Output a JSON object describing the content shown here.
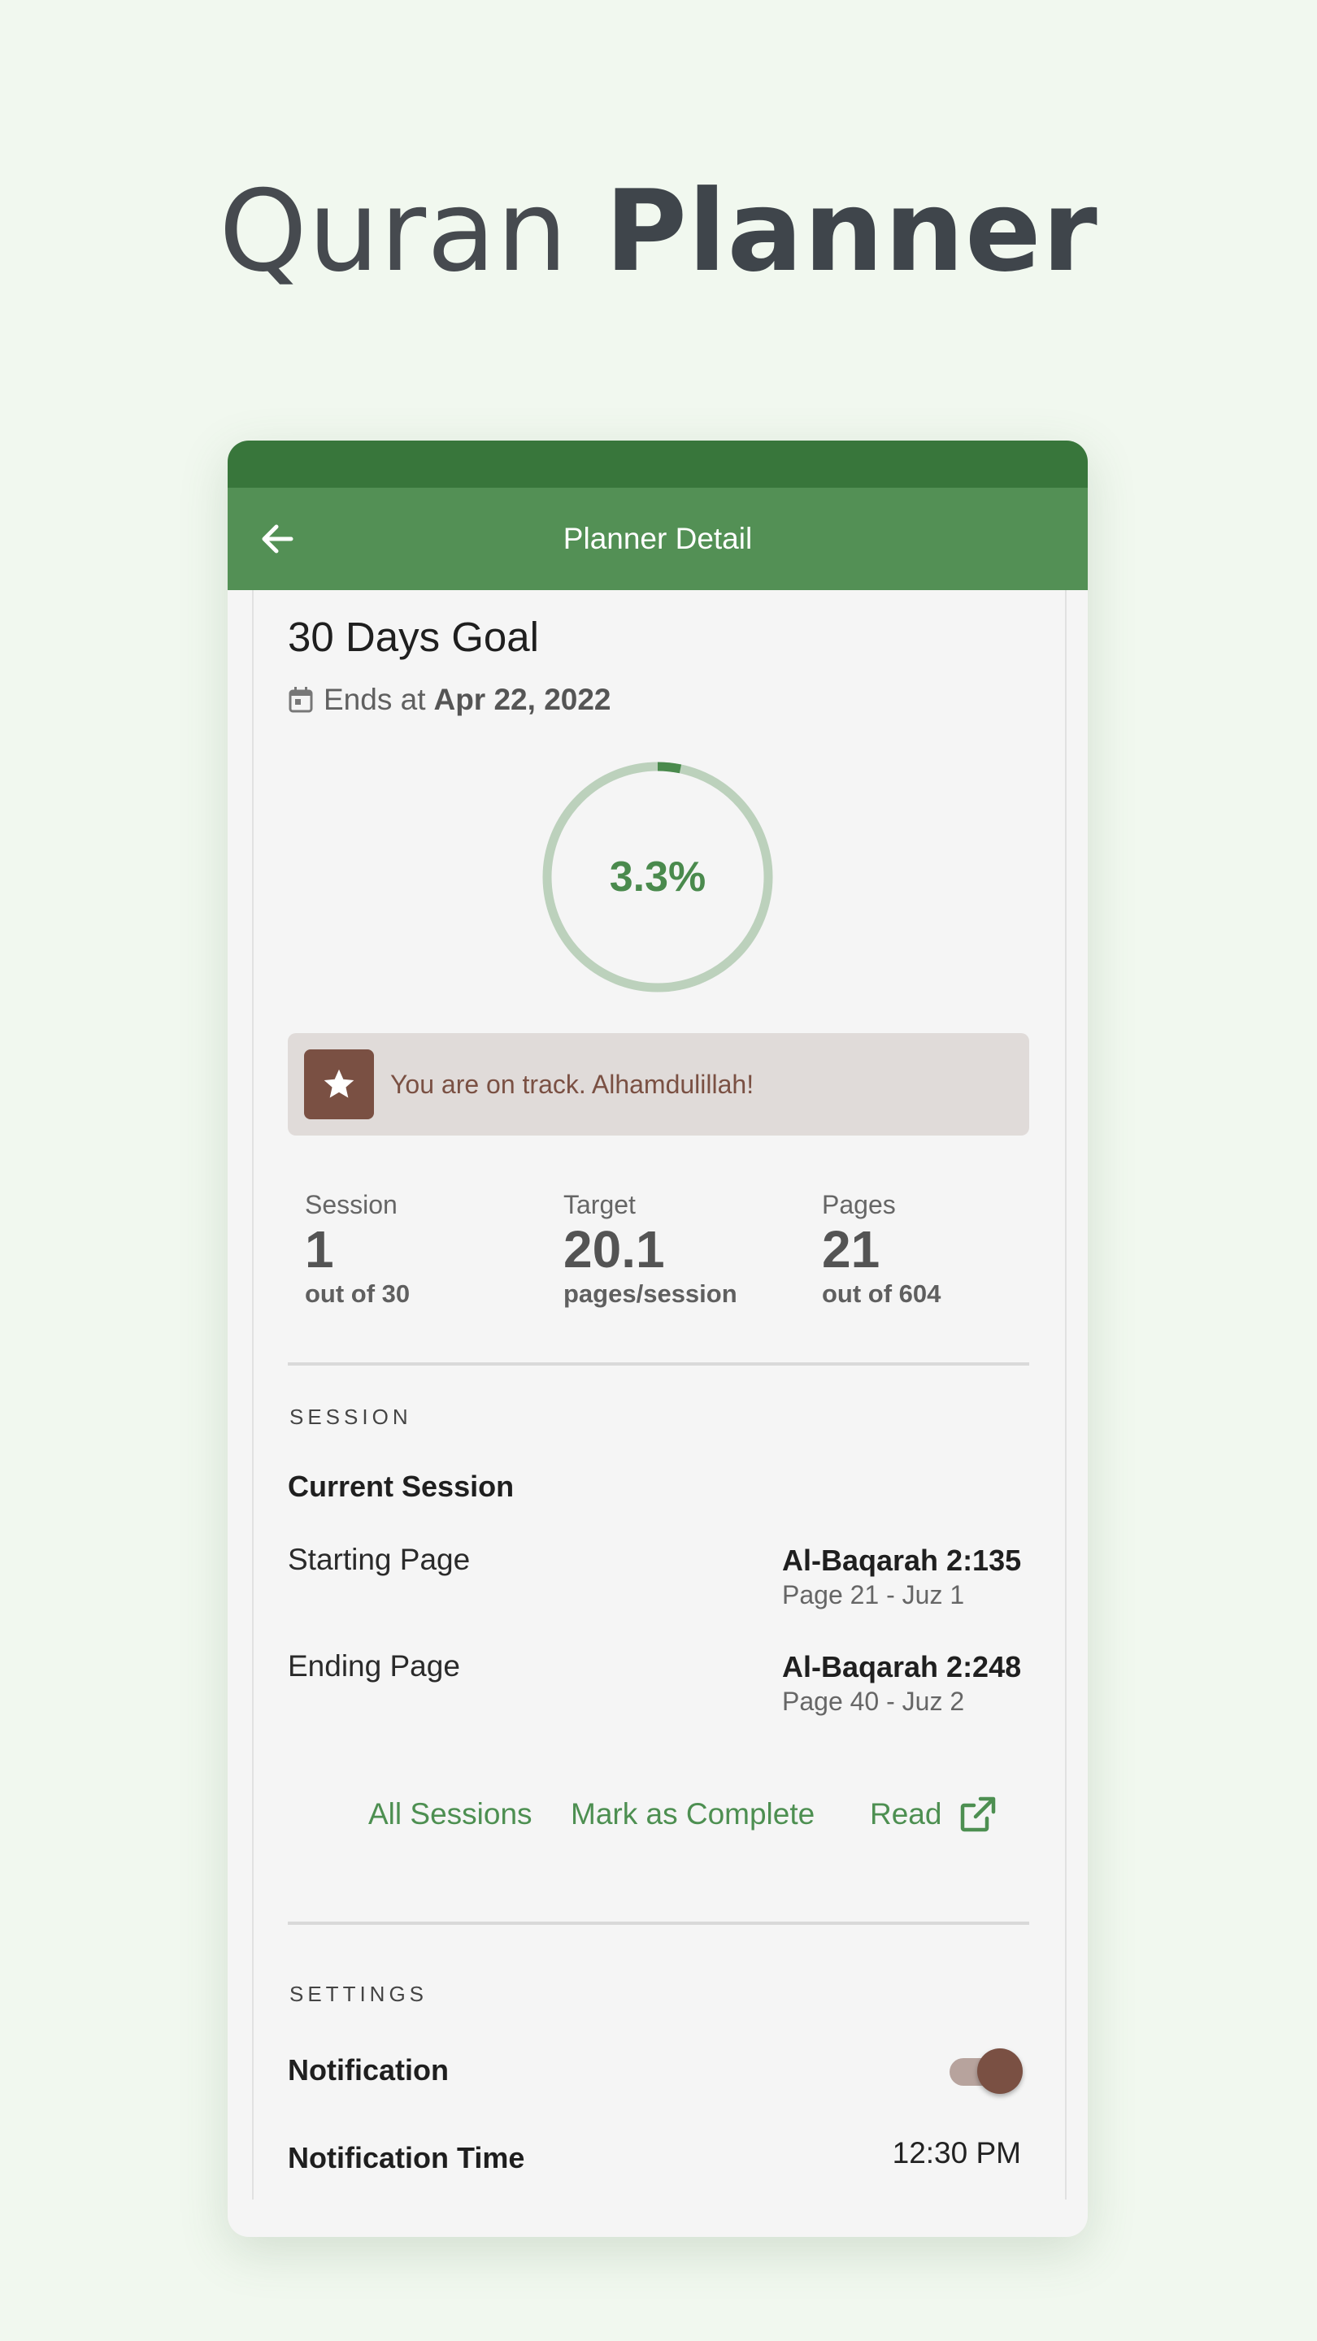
{
  "hero": {
    "title_light": "Quran",
    "title_bold": "Planner"
  },
  "appbar": {
    "title": "Planner Detail",
    "back_icon": "arrow-left-icon"
  },
  "goal": {
    "title": "30 Days Goal",
    "ends_label": "Ends at",
    "ends_date": "Apr 22, 2022",
    "progress_text": "3.3%",
    "progress_fraction": 0.033
  },
  "banner": {
    "text": "You are on track. Alhamdulillah!",
    "icon": "star-icon"
  },
  "stats": [
    {
      "label": "Session",
      "value": "1",
      "sub": "out of 30"
    },
    {
      "label": "Target",
      "value": "20.1",
      "sub": "pages/session"
    },
    {
      "label": "Pages",
      "value": "21",
      "sub": "out of 604"
    }
  ],
  "session": {
    "heading": "SESSION",
    "current_label": "Current Session",
    "start_label": "Starting Page",
    "start_ref": "Al-Baqarah 2:135",
    "start_sub": "Page 21 - Juz 1",
    "end_label": "Ending Page",
    "end_ref": "Al-Baqarah 2:248",
    "end_sub": "Page 40 - Juz 2",
    "actions": {
      "all_sessions": "All Sessions",
      "mark_complete": "Mark as Complete",
      "read": "Read"
    }
  },
  "settings": {
    "heading": "SETTINGS",
    "notification_label": "Notification",
    "notification_on": true,
    "time_label": "Notification Time",
    "time_value": "12:30 PM"
  },
  "colors": {
    "primary": "#539055",
    "primary_dark": "#38763b",
    "accent_brown": "#7a5043",
    "background": "#f1f8ef"
  }
}
